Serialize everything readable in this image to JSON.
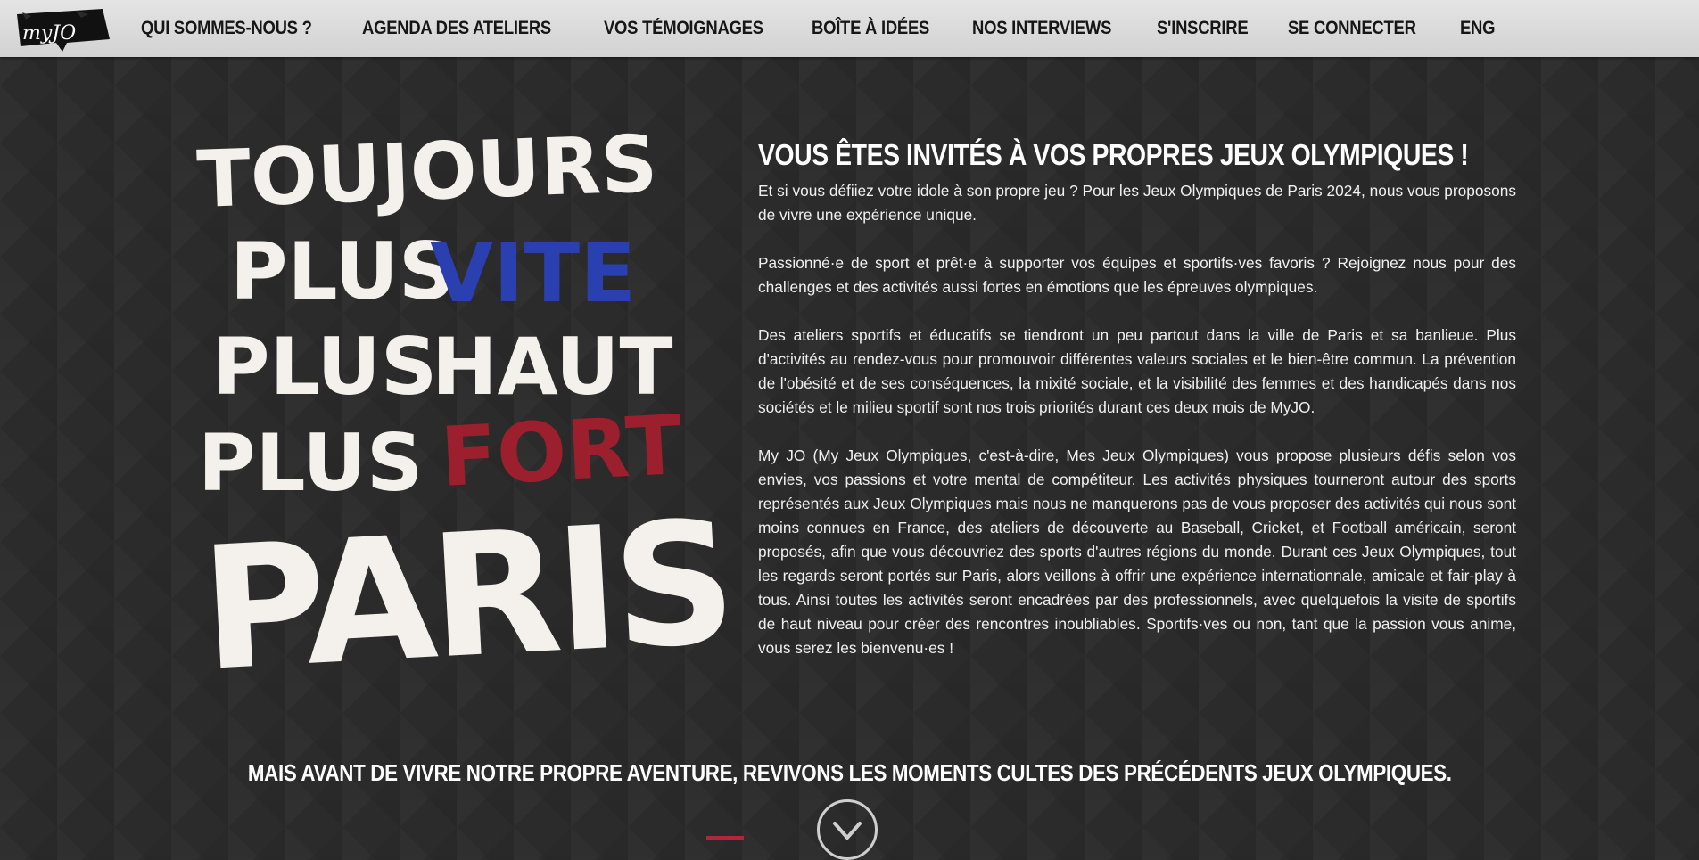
{
  "logo": {
    "text": "myJO"
  },
  "nav": {
    "items": [
      {
        "label": "QUI SOMMES-NOUS ?"
      },
      {
        "label": "AGENDA DES ATELIERS"
      },
      {
        "label": "VOS TÉMOIGNAGES"
      },
      {
        "label": "BOÎTE À IDÉES"
      },
      {
        "label": "NOS INTERVIEWS"
      },
      {
        "label": "S'INSCRIRE"
      },
      {
        "label": "SE CONNECTER"
      },
      {
        "label": "ENG"
      }
    ]
  },
  "poster": {
    "line1": "TOUJOURS",
    "line2_a": "PLUS",
    "line2_b": "VITE",
    "line3_a": "PLUS",
    "line3_b": "HAUT",
    "line4_a": "PLUS",
    "line4_b": "FORT",
    "line5": "PARIS",
    "colors": {
      "white": "#f4f1ec",
      "blue": "#2a3fb0",
      "red": "#9b1f2c"
    }
  },
  "main": {
    "headline": "VOUS ÊTES INVITÉS À VOS PROPRES JEUX OLYMPIQUES !",
    "paragraphs": [
      "Et si vous défiiez votre idole à son propre jeu ? Pour les Jeux Olympiques de Paris 2024, nous vous proposons de vivre une expérience unique.",
      "Passionné·e de sport et prêt·e à supporter vos équipes et sportifs·ves favoris ? Rejoignez nous pour des challenges et des activités aussi fortes en émotions que les épreuves olympiques.",
      "Des ateliers sportifs et éducatifs se tiendront un peu partout dans la ville de Paris et sa banlieue. Plus d'activités au rendez-vous pour promouvoir différentes valeurs sociales et le bien-être commun. La prévention de l'obésité et de ses conséquences, la mixité sociale, et la visibilité des femmes et des handicapés dans nos sociétés et le milieu sportif sont nos trois priorités durant ces deux mois de MyJO.",
      "My JO (My Jeux Olympiques, c'est-à-dire, Mes Jeux Olympiques) vous propose plusieurs défis selon vos envies, vos passions et votre mental de compétiteur. Les activités physiques tourneront autour des sports représentés aux Jeux Olympiques mais nous ne manquerons pas de vous proposer des activités qui nous sont moins connues en France, des ateliers de découverte au Baseball, Cricket, et Football américain, seront proposés, afin que vous découvriez des sports d'autres régions du monde. Durant ces Jeux Olympiques, tout les regards seront portés sur Paris, alors veillons à offrir une expérience internationnale, amicale et fair-play à tous. Ainsi toutes les activités seront encadrées par des professionnels, avec quelquefois la visite de sportifs de haut niveau pour créer des rencontres inoubliables. Sportifs·ves ou non, tant que la passion vous anime, vous serez les bienvenu·es !"
    ]
  },
  "bottom": {
    "title": "MAIS AVANT DE VIVRE NOTRE PROPRE AVENTURE, REVIVONS LES MOMENTS CULTES DES PRÉCÉDENTS JEUX OLYMPIQUES."
  }
}
